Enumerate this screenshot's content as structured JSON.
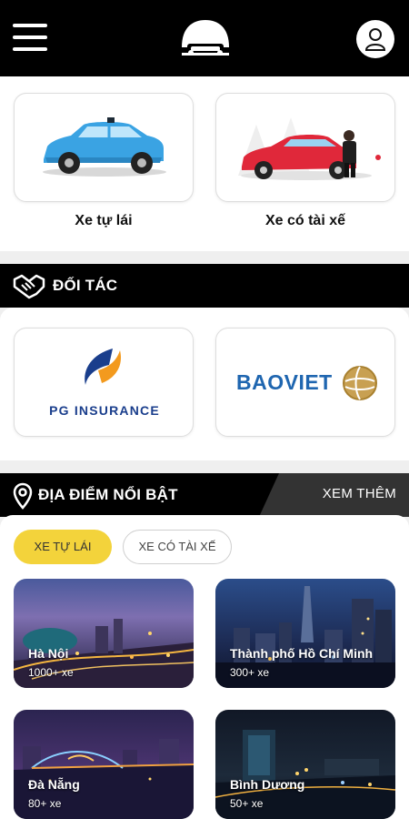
{
  "header": {
    "menu_icon": "hamburger-menu-icon",
    "logo_icon": "car-front-logo",
    "profile_icon": "user-profile-icon"
  },
  "services": [
    {
      "label": "Xe tự lái",
      "icon": "blue-self-drive-car"
    },
    {
      "label": "Xe có tài xế",
      "icon": "red-car-with-driver"
    }
  ],
  "partners": {
    "title": "ĐỐI TÁC",
    "icon": "handshake-icon",
    "items": [
      {
        "name": "PG INSURANCE",
        "brand_color": "#1a3e8c"
      },
      {
        "name": "BAOVIET",
        "brand_color": "#1f66b0"
      }
    ]
  },
  "locations": {
    "title": "ĐỊA ĐIỂM NỔI BẬT",
    "icon": "map-pin-icon",
    "see_more": "XEM THÊM",
    "tabs": [
      {
        "label": "XE TỰ LÁI",
        "active": true
      },
      {
        "label": "XE CÓ TÀI XẾ",
        "active": false
      }
    ],
    "cities": [
      {
        "name": "Hà Nội",
        "count": "1000+ xe"
      },
      {
        "name": "Thành phố Hồ Chí Minh",
        "count": "300+ xe"
      },
      {
        "name": "Đà Nẵng",
        "count": "80+ xe"
      },
      {
        "name": "Bình Dương",
        "count": "50+ xe"
      }
    ]
  },
  "colors": {
    "header_bg": "#000000",
    "accent_yellow": "#f3d33b",
    "page_bg": "#efefef"
  }
}
